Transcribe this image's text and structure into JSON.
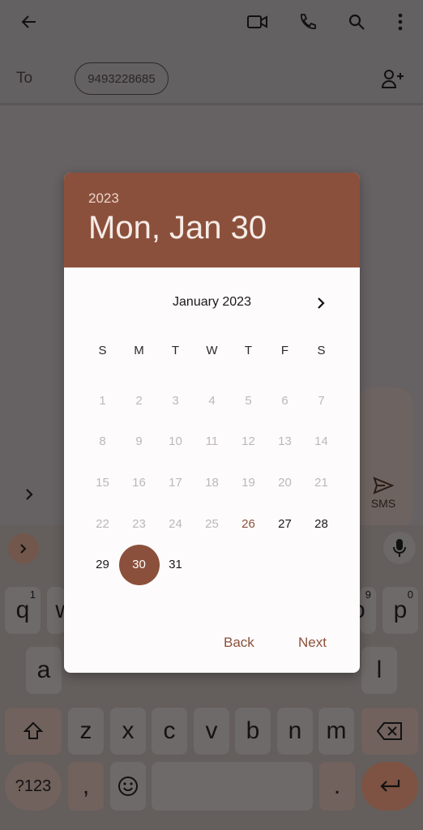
{
  "topbar": {
    "icons": [
      "back-arrow-icon",
      "video-call-icon",
      "phone-icon",
      "search-icon",
      "more-vert-icon"
    ]
  },
  "recipient": {
    "to_label": "To",
    "chip": "9493228685",
    "add_icon": "add-contact-icon"
  },
  "compose": {
    "send_label": "SMS",
    "expand_icon": "chevron-right-icon"
  },
  "keyboard": {
    "row1": [
      {
        "k": "q",
        "s": "1"
      },
      {
        "k": "w",
        "s": ""
      },
      {
        "k": "o",
        "s": "9"
      },
      {
        "k": "p",
        "s": "0"
      }
    ],
    "row2": [
      "a",
      "l"
    ],
    "row3": [
      "z",
      "x",
      "c",
      "v",
      "b",
      "n",
      "m"
    ],
    "symbols": "?123",
    "comma": ",",
    "period": ".",
    "icons": [
      "chevron-right-icon",
      "mic-icon",
      "shift-icon",
      "backspace-icon",
      "emoji-icon",
      "enter-icon"
    ]
  },
  "dialog": {
    "year": "2023",
    "date": "Mon, Jan 30",
    "month": "January 2023",
    "weekdays": [
      "S",
      "M",
      "T",
      "W",
      "T",
      "F",
      "S"
    ],
    "days": [
      "1",
      "2",
      "3",
      "4",
      "5",
      "6",
      "7",
      "8",
      "9",
      "10",
      "11",
      "12",
      "13",
      "14",
      "15",
      "16",
      "17",
      "18",
      "19",
      "20",
      "21",
      "22",
      "23",
      "24",
      "25",
      "26",
      "27",
      "28",
      "29",
      "30",
      "31"
    ],
    "today": "26",
    "selected": "30",
    "first_enabled": "26",
    "back": "Back",
    "next": "Next",
    "accent": "#8b503b"
  }
}
